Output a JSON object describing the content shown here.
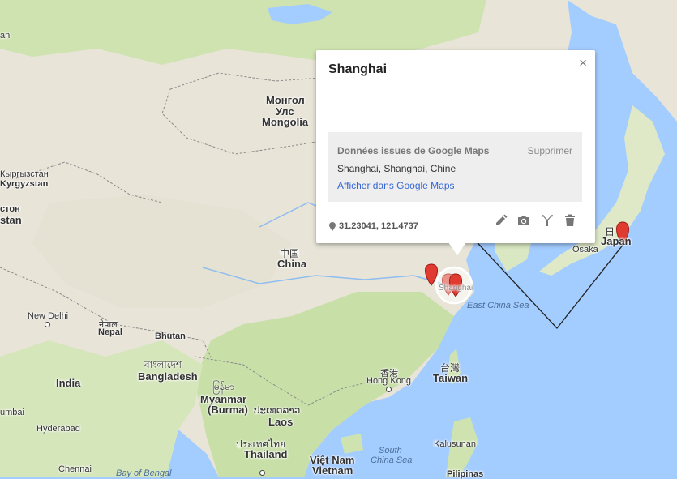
{
  "popup": {
    "title": "Shanghai",
    "close": "×",
    "source_label": "Données issues de Google Maps",
    "delete_label": "Supprimer",
    "place": "Shanghai, Shanghai, Chine",
    "link": "Afficher dans Google Maps",
    "coordinates": "31.23041, 121.4737",
    "tools": [
      "pencil-icon",
      "camera-icon",
      "directions-icon",
      "trash-icon"
    ]
  },
  "labels": {
    "mongolia_native": "Монгол",
    "mongolia_native2": "Улс",
    "mongolia": "Mongolia",
    "kyrgyz_native": "Кыргызстан",
    "kyrgyzstan": "Kyrgyzstan",
    "stan_native": "стон",
    "stan": "stan",
    "china_native": "中国",
    "china": "China",
    "new_delhi": "New Delhi",
    "nepal_native": "नेपाल",
    "nepal": "Nepal",
    "bhutan": "Bhutan",
    "bangladesh_native": "বাংলাদেশ",
    "bangladesh": "Bangladesh",
    "india": "India",
    "myanmar_native": "မြန်မာ",
    "myanmar": "Myanmar",
    "burma": "(Burma)",
    "laos_native": "ປະເທດລາວ",
    "laos": "Laos",
    "thailand_native": "ประเทศไทย",
    "thailand": "Thailand",
    "vietnam_native": "Việt Nam",
    "vietnam": "Vietnam",
    "hong_kong_native": "香港",
    "hong_kong": "Hong Kong",
    "taiwan_native": "台灣",
    "taiwan": "Taiwan",
    "east_china_sea": "East China Sea",
    "south_china_sea_1": "South",
    "south_china_sea_2": "China Sea",
    "bay_of_bengal": "Bay of Bengal",
    "kalusunan": "Kalusunan",
    "pilipinas": "Pilipinas",
    "osaka": "Osaka",
    "japan_native": "日",
    "japan": "Japan",
    "hyderabad": "Hyderabad",
    "chennai": "Chennai",
    "mumbai": "umbai",
    "shanghai_map": "Shanghai",
    "an": "an"
  },
  "colors": {
    "water": "#a3ccff",
    "land": "#eeeae2",
    "vegetation": "#cde2b3",
    "marker": "#e03b30",
    "route": "#222222",
    "link": "#3367d6"
  }
}
